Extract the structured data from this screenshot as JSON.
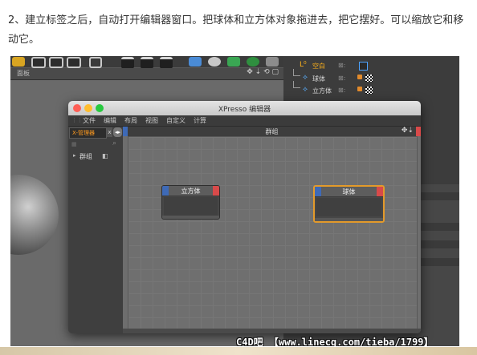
{
  "caption": "2、建立标签之后，自动打开编辑器窗口。把球体和立方体对象拖进去，把它摆好。可以缩放它和移动它。",
  "c4d": {
    "panel_title": "面板",
    "panel_tools": "✥ ⇣ ⟲ ▢"
  },
  "object_manager": {
    "objects": [
      {
        "label": "空白",
        "glyph": "L⁰",
        "color": "#ffb21a"
      },
      {
        "label": "球体",
        "glyph": "⟡",
        "color": "#5ab0ff"
      },
      {
        "label": "立方体",
        "glyph": "⟡",
        "color": "#5ab0ff"
      }
    ],
    "check": "⊠:"
  },
  "xpresso": {
    "window_title": "XPresso 编辑器",
    "menu": [
      "文件",
      "编辑",
      "布局",
      "视图",
      "自定义",
      "计算"
    ],
    "xmanager": {
      "tab_label": "X-管理器",
      "close": "x",
      "toggle": "◂▸",
      "search_icon": "⌕",
      "grid_icon": "▦",
      "group_arrow": "▸",
      "group_label": "群组",
      "group_icon": "◧"
    },
    "canvas": {
      "title": "群组",
      "tools": "✥⇣"
    },
    "nodes": [
      {
        "title": "立方体",
        "selected": false
      },
      {
        "title": "球体",
        "selected": true
      }
    ]
  },
  "watermark": "C4D吧 【www.linecg.com/tieba/1799】",
  "colors": {
    "accent_orange": "#ff9a1f",
    "port_input": "#3e6ab7",
    "port_output": "#d84a4a",
    "selection": "#e39a2a",
    "axis_green": "#4cd14c"
  }
}
